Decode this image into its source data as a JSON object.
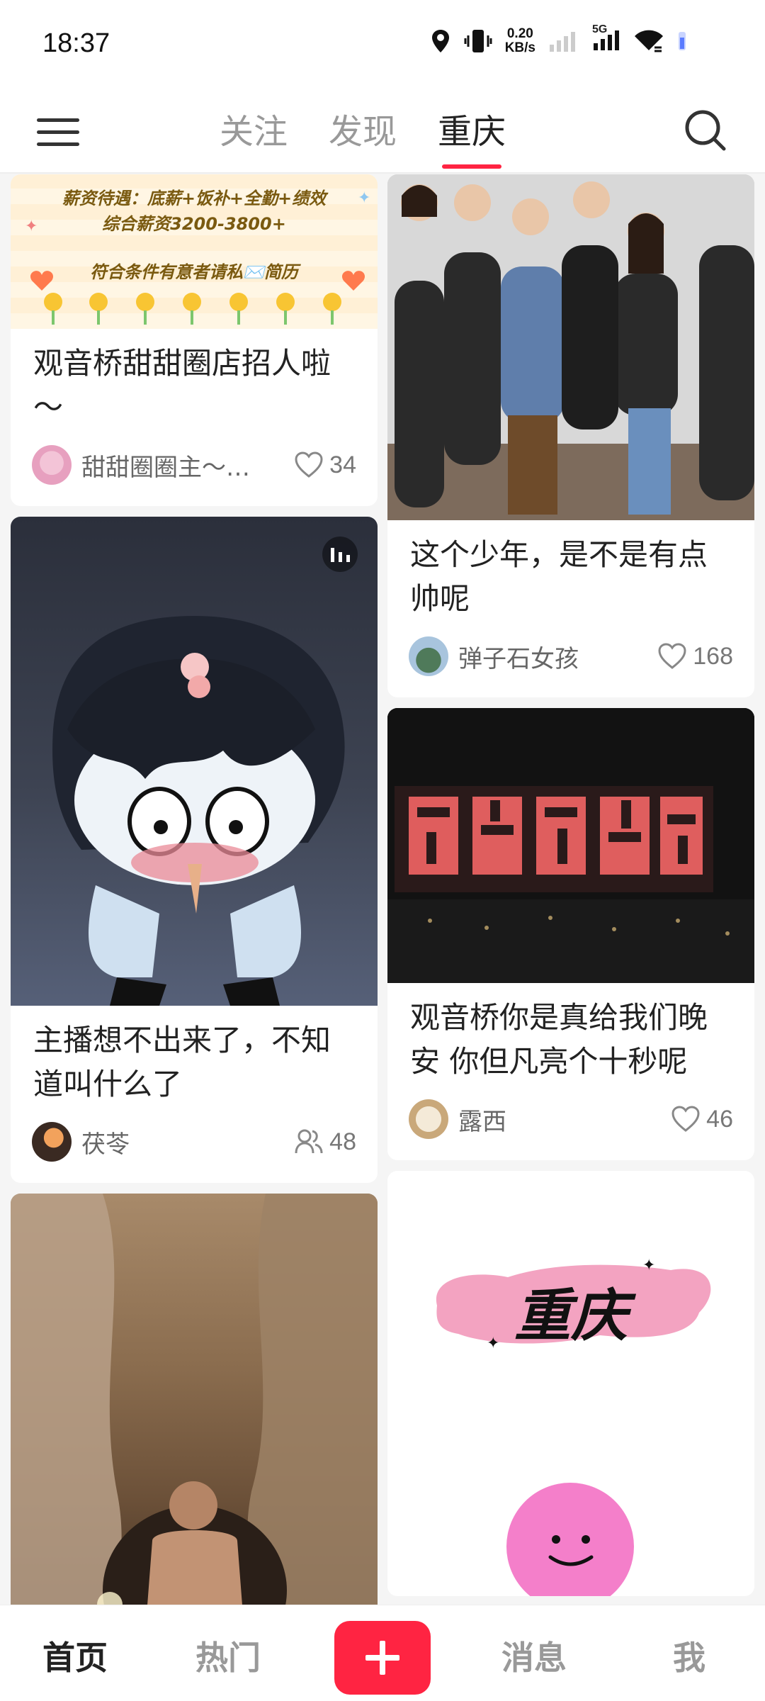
{
  "status_bar": {
    "time": "18:37",
    "net_speed_value": "0.20",
    "net_speed_unit": "KB/s",
    "network_type": "5G"
  },
  "top_nav": {
    "tabs": [
      {
        "label": "关注",
        "active": false
      },
      {
        "label": "发现",
        "active": false
      },
      {
        "label": "重庆",
        "active": true
      }
    ]
  },
  "feed": {
    "left": [
      {
        "banner_line1": "薪资待遇：底薪+饭补+全勤+绩效",
        "banner_line2": "综合薪资3200-3800+",
        "banner_line3": "符合条件有意者请私✉️简历",
        "title": "观音桥甜甜圈店招人啦～",
        "author": "甜甜圈圈主～…",
        "count": "34",
        "count_icon": "heart-icon"
      },
      {
        "title": "主播想不出来了，不知道叫什么了",
        "author": "茯苓",
        "count": "48",
        "count_icon": "people-icon"
      },
      {
        "title": "",
        "author": "",
        "count": ""
      }
    ],
    "right": [
      {
        "title": "这个少年，是不是有点帅呢",
        "author": "弹子石女孩",
        "count": "168",
        "count_icon": "heart-icon"
      },
      {
        "title": "观音桥你是真给我们晚安 你但凡亮个十秒呢",
        "author": "露西",
        "count": "46",
        "count_icon": "heart-icon"
      },
      {
        "sticker_text": "重庆"
      }
    ]
  },
  "bottom_nav": {
    "home": "首页",
    "hot": "热门",
    "plus": "+",
    "messages": "消息",
    "me": "我"
  },
  "colors": {
    "accent": "#ff2442",
    "background": "#f5f5f5"
  }
}
